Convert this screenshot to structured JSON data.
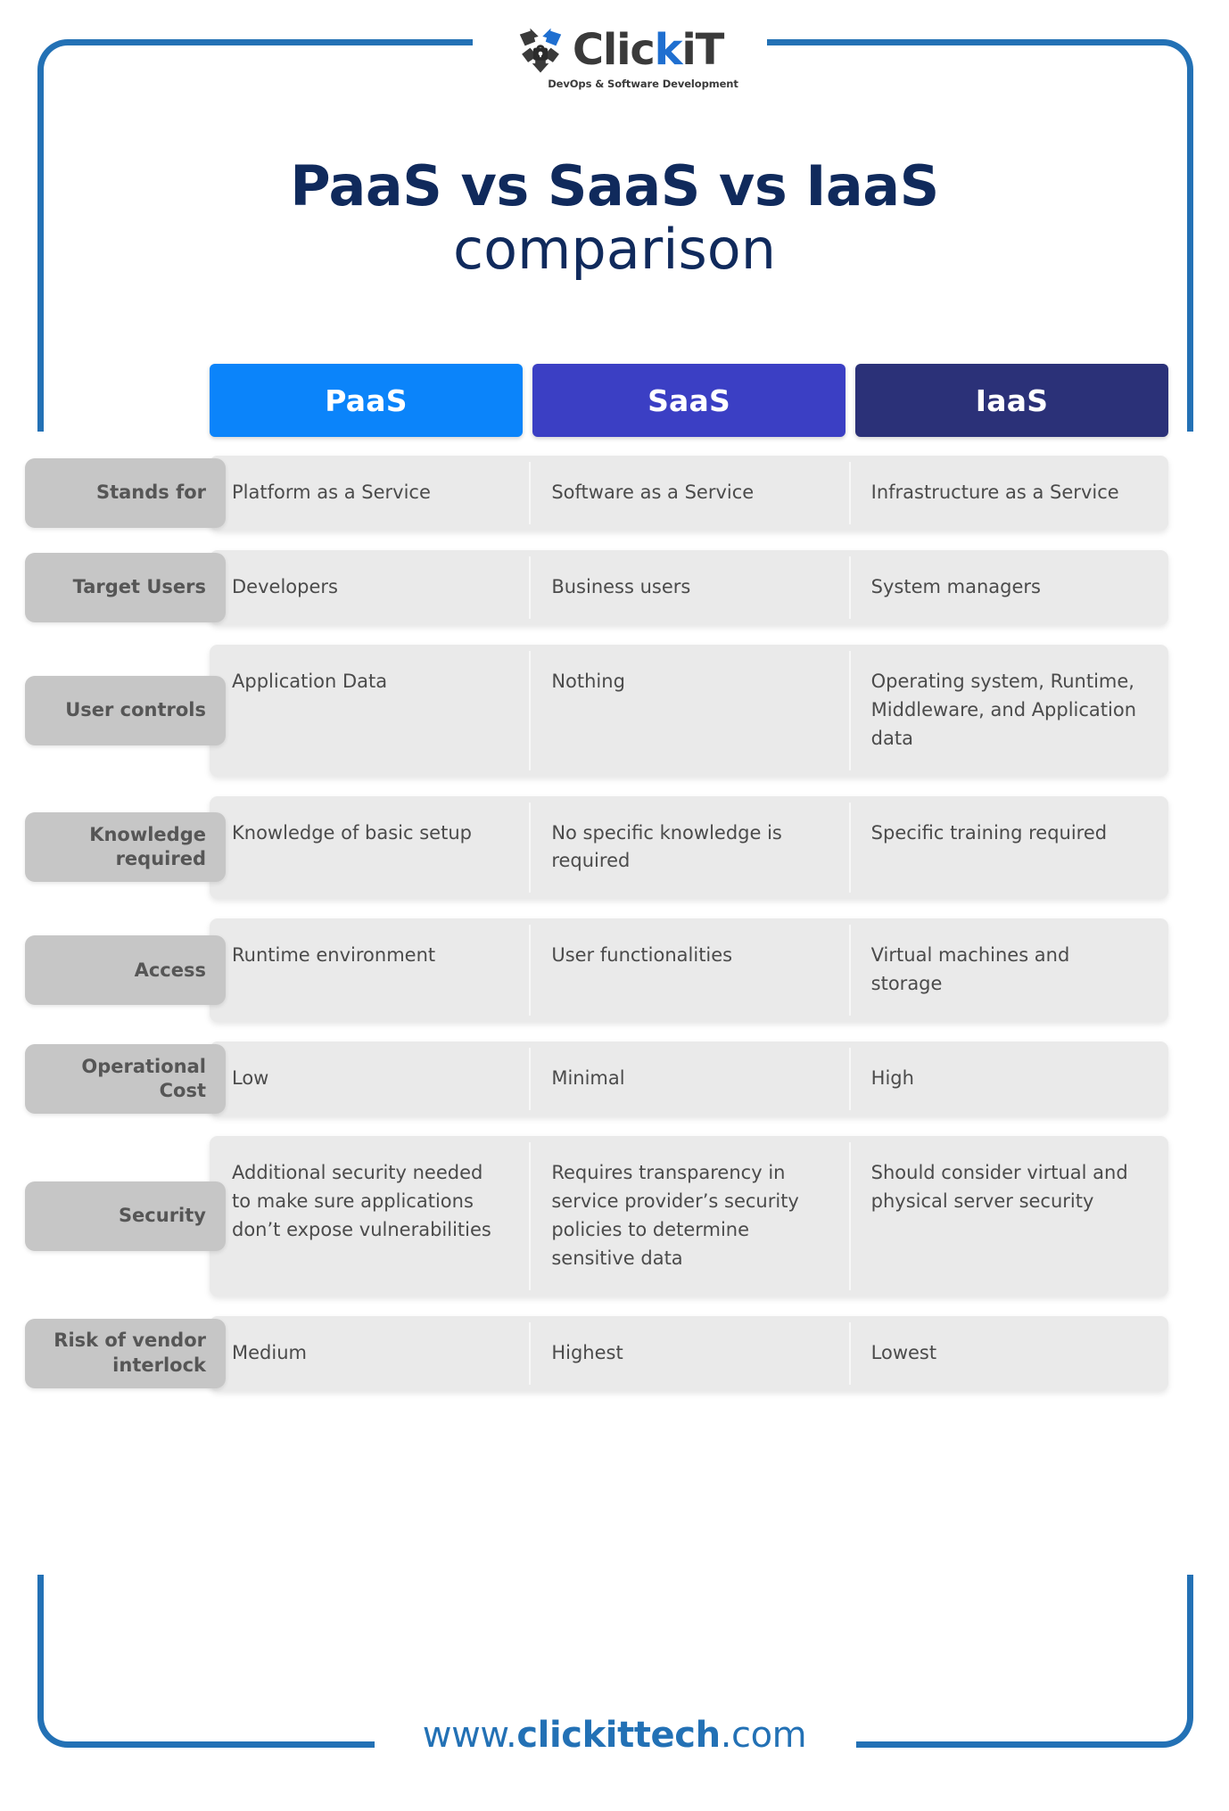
{
  "brand": {
    "logo_name_part1": "Clic",
    "logo_name_k": "k",
    "logo_name_part2": "iT",
    "tagline": "DevOps & Software Development",
    "shield_icon": "shield-lock-icon"
  },
  "title": {
    "line1": "PaaS vs SaaS vs IaaS",
    "line2": "comparison"
  },
  "colors": {
    "paas": "#0b84fa",
    "saas": "#3b3fc4",
    "iaas": "#2b3178",
    "frame_blue": "#2371b5",
    "title_navy": "#102a5c",
    "pill_gray": "#c6c6c6",
    "card_gray": "#eaeaea"
  },
  "columns": [
    {
      "label": "PaaS",
      "color": "#0b84fa"
    },
    {
      "label": "SaaS",
      "color": "#3b3fc4"
    },
    {
      "label": "IaaS",
      "color": "#2b3178"
    }
  ],
  "rows": [
    {
      "label": "Stands for",
      "cells": [
        "Platform as a Service",
        "Software as a Service",
        "Infrastructure as a Service"
      ]
    },
    {
      "label": "Target Users",
      "cells": [
        "Developers",
        "Business users",
        "System managers"
      ]
    },
    {
      "label": "User controls",
      "cells": [
        "Application Data",
        "Nothing",
        "Operating system, Runtime, Middleware, and Application data"
      ]
    },
    {
      "label": "Knowledge required",
      "cells": [
        "Knowledge of basic setup",
        "No specific knowledge is required",
        "Specific training required"
      ]
    },
    {
      "label": "Access",
      "cells": [
        "Runtime environment",
        "User functionalities",
        "Virtual machines and storage"
      ]
    },
    {
      "label": "Operational Cost",
      "cells": [
        "Low",
        "Minimal",
        "High"
      ]
    },
    {
      "label": "Security",
      "cells": [
        "Additional security needed to make sure applications don’t expose vulnerabilities",
        "Requires transparency in service provider’s security policies to determine sensitive data",
        "Should consider virtual and physical server security"
      ]
    },
    {
      "label": "Risk of vendor interlock",
      "cells": [
        "Medium",
        "Highest",
        "Lowest"
      ]
    }
  ],
  "footer": {
    "url_www": "www.",
    "url_mid": "clickittech",
    "url_tld": ".com"
  }
}
